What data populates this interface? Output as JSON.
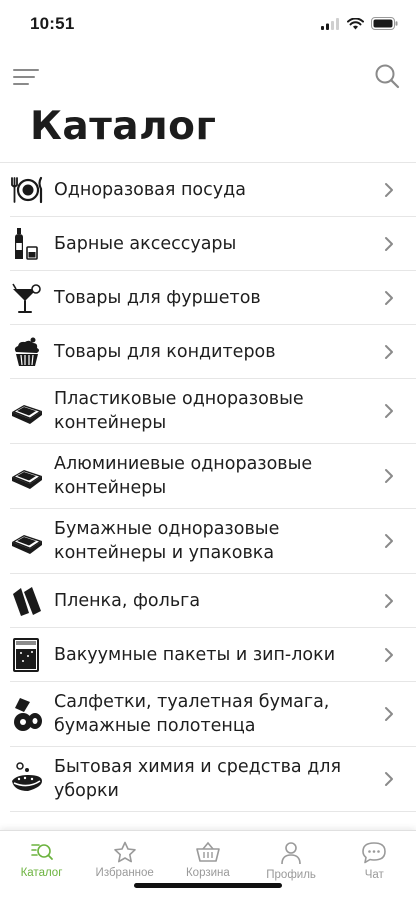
{
  "status_bar": {
    "time": "10:51"
  },
  "header": {
    "title": "Каталог"
  },
  "catalog": [
    {
      "label": "Одноразовая посуда",
      "icon": "plate-cutlery-icon",
      "h": 54
    },
    {
      "label": "Барные аксессуары",
      "icon": "bottle-glass-icon",
      "h": 54
    },
    {
      "label": "Товары для фуршетов",
      "icon": "cocktail-glass-icon",
      "h": 54
    },
    {
      "label": "Товары для кондитеров",
      "icon": "cupcake-icon",
      "h": 54
    },
    {
      "label": "Пластиковые одноразовые контейнеры",
      "icon": "container-icon",
      "h": 65
    },
    {
      "label": "Алюминиевые одноразовые контейнеры",
      "icon": "container-icon",
      "h": 65
    },
    {
      "label": "Бумажные одноразовые контейнеры и упаковка",
      "icon": "container-icon",
      "h": 65
    },
    {
      "label": "Пленка, фольга",
      "icon": "foil-roll-icon",
      "h": 54
    },
    {
      "label": "Вакуумные пакеты и зип-локи",
      "icon": "vacuum-bag-icon",
      "h": 54
    },
    {
      "label": "Салфетки, туалетная бумага, бумажные полотенца",
      "icon": "paper-roll-icon",
      "h": 65
    },
    {
      "label": "Бытовая химия и средства для уборки",
      "icon": "sponge-bubbles-icon",
      "h": 65
    }
  ],
  "tabs": [
    {
      "label": "Каталог",
      "icon": "catalog-search-icon",
      "active": true
    },
    {
      "label": "Избранное",
      "icon": "star-icon",
      "active": false
    },
    {
      "label": "Корзина",
      "icon": "basket-icon",
      "active": false
    },
    {
      "label": "Профиль",
      "icon": "person-icon",
      "active": false
    },
    {
      "label": "Чат",
      "icon": "chat-bubble-icon",
      "active": false
    }
  ],
  "colors": {
    "accent": "#6cb33f",
    "inactive": "#9a9a9a",
    "text": "#1e1e1e"
  }
}
